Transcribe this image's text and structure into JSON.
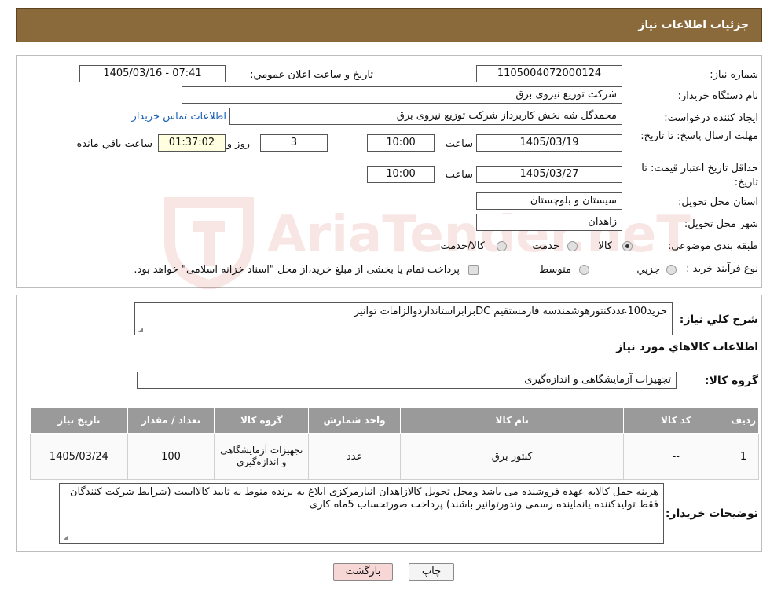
{
  "header": {
    "title": "جزئیات اطلاعات نیاز"
  },
  "info": {
    "need_number_label": "شماره نیاز:",
    "need_number": "1105004072000124",
    "announce_label": "تاریخ و ساعت اعلان عمومي:",
    "announce_value": "1405/03/16 - 07:41",
    "buyer_org_label": "نام دستگاه خريدار:",
    "buyer_org": "شرکت توزیع نیروی برق",
    "requester_label": "ايجاد کننده درخواست:",
    "requester": "محمدگل شه بخش کاربرداز شرکت توزیع نیروی برق",
    "contact_link": "اطلاعات تماس خريدار",
    "reply_deadline_label": "مهلت ارسال پاسخ: تا تاریخ:",
    "reply_date": "1405/03/19",
    "time_label": "ساعت",
    "reply_time": "10:00",
    "days_value": "3",
    "days_label": "روز و",
    "remaining_time": "01:37:02",
    "remaining_label": "ساعت باقي مانده",
    "price_validity_label": "حداقل تاريخ اعتبار قيمت: تا تاریخ:",
    "price_date": "1405/03/27",
    "price_time": "10:00",
    "province_label": "استان محل تحويل:",
    "province": "سیستان و بلوچستان",
    "city_label": "شهر محل تحويل:",
    "city": "زاهدان",
    "category_label": "طبقه بندی موضوعی:",
    "category_options": [
      "کالا",
      "خدمت",
      "کالا/خدمت"
    ],
    "category_selected": "کالا",
    "process_label": "نوع فرآيند خريد :",
    "process_options": [
      "جزيي",
      "متوسط"
    ],
    "process_note": "پرداخت تمام یا بخشی از مبلغ خرید،از محل \"اسناد خزانه اسلامی\" خواهد بود."
  },
  "summary": {
    "label": "شرح کلي نياز:",
    "text": "خرید100عددکنتورهوشمندسه فازمستقیم DCبرابراستانداردوالزامات توانیر"
  },
  "goods": {
    "section_title": "اطلاعات کالاهاي مورد نياز",
    "group_label": "گروه کالا:",
    "group_value": "تجهیزات آزمایشگاهی و اندازه‌گیری",
    "columns": [
      "رديف",
      "کد کالا",
      "نام کالا",
      "واحد شمارش",
      "گروه کالا",
      "تعداد / مقدار",
      "تاريخ نياز"
    ],
    "rows": [
      [
        "1",
        "--",
        "کنتور برق",
        "عدد",
        "تجهیزات آزمایشگاهی و اندازه‌گیری",
        "100",
        "1405/03/24"
      ]
    ]
  },
  "notes": {
    "label": "توضيحات خريدار:",
    "text": "هزینه حمل کالابه عهده فروشنده می باشد ومحل تحویل کالازاهدان انبارمرکزی ابلاغ به برنده منوط به تایید کالااست (شرایط شرکت کنندگان فقط تولیدکننده یانماینده رسمی    وندورتوانیر باشند) پرداخت صورتحساب 5ماه کاری"
  },
  "buttons": {
    "print": "چاپ",
    "back": "بازگشت"
  },
  "watermark": "AriaTender.neT",
  "colors": {
    "header_bg": "#8a6a3a",
    "table_header_bg": "#9a9a9a",
    "back_button_bg": "#f7d6d6",
    "watermark": "#c0392b"
  }
}
